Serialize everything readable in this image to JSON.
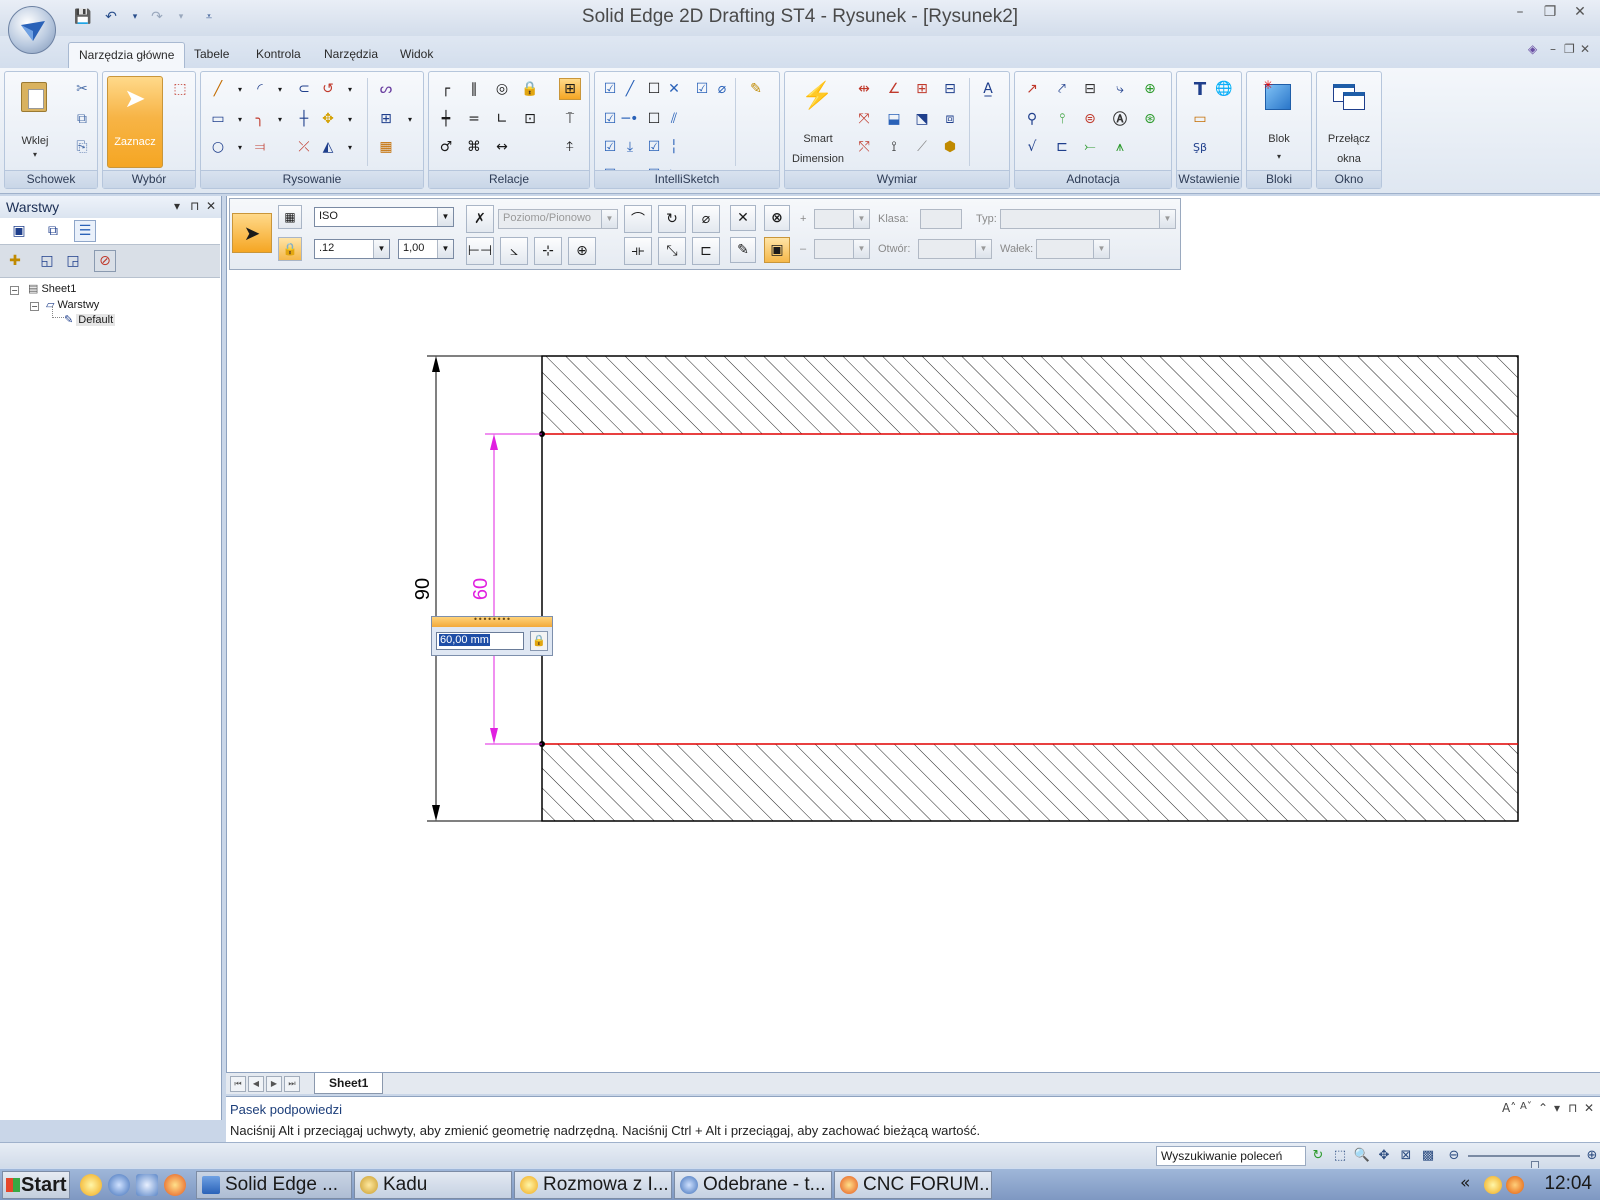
{
  "window": {
    "title": "Solid Edge 2D Drafting ST4 - Rysunek - [Rysunek2]"
  },
  "ribbon": {
    "tabs": [
      {
        "label": "Narzędzia główne",
        "active": true
      },
      {
        "label": "Tabele"
      },
      {
        "label": "Kontrola"
      },
      {
        "label": "Narzędzia"
      },
      {
        "label": "Widok"
      }
    ],
    "groups": {
      "schowek": {
        "label": "Schowek",
        "paste": "Wklej"
      },
      "wybor": {
        "label": "Wybór",
        "select": "Zaznacz"
      },
      "rysowanie": {
        "label": "Rysowanie"
      },
      "relacje": {
        "label": "Relacje"
      },
      "intellisketch": {
        "label": "IntelliSketch"
      },
      "wymiar": {
        "label": "Wymiar",
        "smart_line1": "Smart",
        "smart_line2": "Dimension"
      },
      "adnotacja": {
        "label": "Adnotacja"
      },
      "wstawienie": {
        "label": "Wstawienie"
      },
      "bloki": {
        "label": "Bloki",
        "block": "Blok"
      },
      "okno": {
        "label": "Okno",
        "switch_line1": "Przełącz",
        "switch_line2": "okna"
      }
    }
  },
  "layers_panel": {
    "title": "Warstwy",
    "tree": {
      "sheet": "Sheet1",
      "layers_node": "Warstwy",
      "layer": "Default"
    }
  },
  "command_bar": {
    "standard": "ISO",
    "font_size": ".12",
    "scale": "1,00",
    "orientation": "Poziomo/Pionowo",
    "class_label": "Klasa:",
    "type_label": "Typ:",
    "hole_label": "Otwór:",
    "shaft_label": "Wałek:",
    "plus": "+",
    "minus": "–"
  },
  "drawing": {
    "dim_outer": "90",
    "dim_inner": "60",
    "edit_value": "60,00 mm",
    "colors": {
      "inner_line": "#e00000",
      "dimension_active": "#e020e0",
      "dimension": "#000000"
    }
  },
  "sheet_tabs": {
    "active": "Sheet1"
  },
  "hint_bar": {
    "title": "Pasek podpowiedzi",
    "text": "Naciśnij Alt i przeciągaj uchwyty, aby zmienić geometrię nadrzędną. Naciśnij Ctrl + Alt i przeciągaj, aby zachować bieżącą wartość."
  },
  "status": {
    "command_search": "Wyszukiwanie poleceń",
    "zoom_level": 0.6
  },
  "taskbar": {
    "start": "Start",
    "tasks": [
      {
        "label": "Solid Edge ...",
        "active": true
      },
      {
        "label": "Kadu"
      },
      {
        "label": "Rozmowa z I..."
      },
      {
        "label": "Odebrane - t..."
      },
      {
        "label": "CNC FORUM..."
      }
    ],
    "clock": "12:04"
  }
}
